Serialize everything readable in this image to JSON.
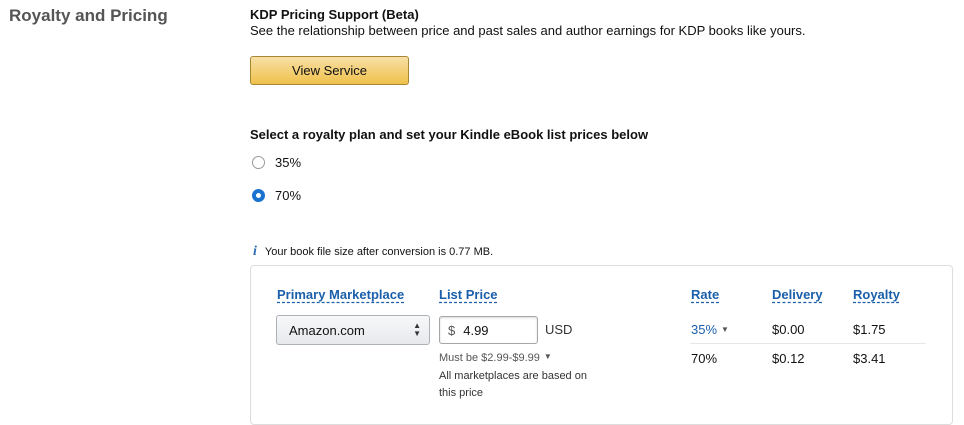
{
  "section": {
    "title": "Royalty and Pricing"
  },
  "kdp_pricing": {
    "title": "KDP Pricing Support (Beta)",
    "description": "See the relationship between price and past sales and author earnings for KDP books like yours.",
    "button_label": "View Service"
  },
  "royalty_plan": {
    "heading": "Select a royalty plan and set your Kindle eBook list prices below",
    "options": [
      {
        "label": "35%",
        "checked": false
      },
      {
        "label": "70%",
        "checked": true
      }
    ]
  },
  "file_info": "Your book file size after conversion is 0.77 MB.",
  "pricing_table": {
    "headers": {
      "marketplace": "Primary Marketplace",
      "list_price": "List Price",
      "rate": "Rate",
      "delivery": "Delivery",
      "royalty": "Royalty"
    },
    "marketplace_selected": "Amazon.com",
    "currency_symbol": "$",
    "list_price_value": "4.99",
    "currency_code": "USD",
    "price_range_note": "Must be $2.99-$9.99",
    "marketplaces_note_line1": "All marketplaces are based on",
    "marketplaces_note_line2": "this price",
    "rows": [
      {
        "rate": "35%",
        "delivery": "$0.00",
        "royalty": "$1.75"
      },
      {
        "rate": "70%",
        "delivery": "$0.12",
        "royalty": "$3.41"
      }
    ]
  },
  "colors": {
    "accent_link": "#1b5faa",
    "radio_selected": "#1b73d1",
    "button_gradient_top": "#f7dfa5",
    "button_gradient_bottom": "#f0c14b"
  },
  "icons": {
    "info": "info-icon",
    "select_arrow": "chevron-updown-icon",
    "caret": "caret-down-icon"
  }
}
